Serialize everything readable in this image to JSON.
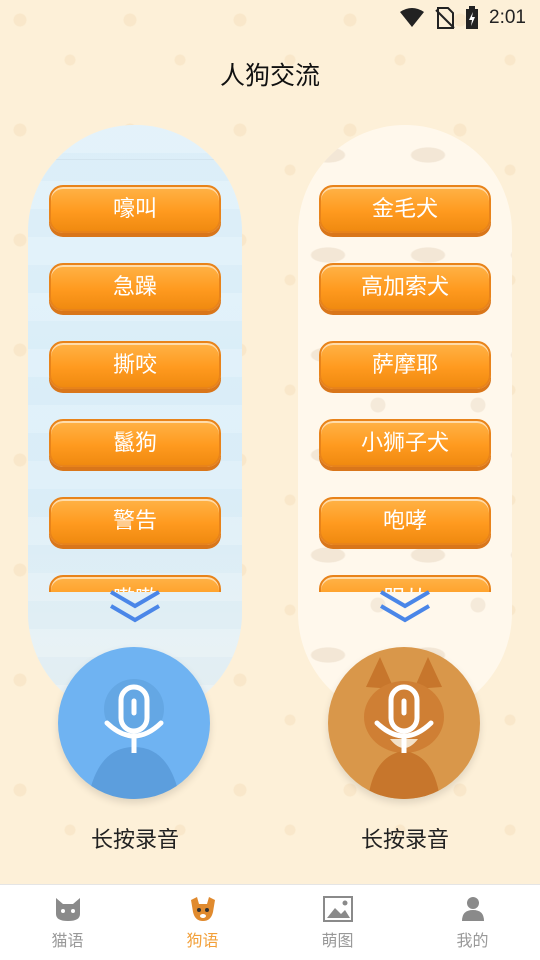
{
  "status_bar": {
    "time": "2:01"
  },
  "header": {
    "title": "人狗交流"
  },
  "left_panel": {
    "buttons": [
      "嚎叫",
      "急躁",
      "撕咬",
      "鬣狗",
      "警告",
      "嗷嗷"
    ],
    "record_label": "长按录音"
  },
  "right_panel": {
    "buttons": [
      "金毛犬",
      "高加索犬",
      "萨摩耶",
      "小狮子犬",
      "咆哮",
      "服从"
    ],
    "record_label": "长按录音"
  },
  "bottom_nav": [
    {
      "label": "猫语",
      "icon": "cat-icon",
      "active": false
    },
    {
      "label": "狗语",
      "icon": "dog-icon",
      "active": true
    },
    {
      "label": "萌图",
      "icon": "image-icon",
      "active": false
    },
    {
      "label": "我的",
      "icon": "person-icon",
      "active": false
    }
  ],
  "colors": {
    "accent": "#f2a03a",
    "button_orange": "#ff9a1f",
    "record_blue": "#6fb3f2",
    "record_tan": "#d9974a",
    "background": "#fdf0d8"
  }
}
